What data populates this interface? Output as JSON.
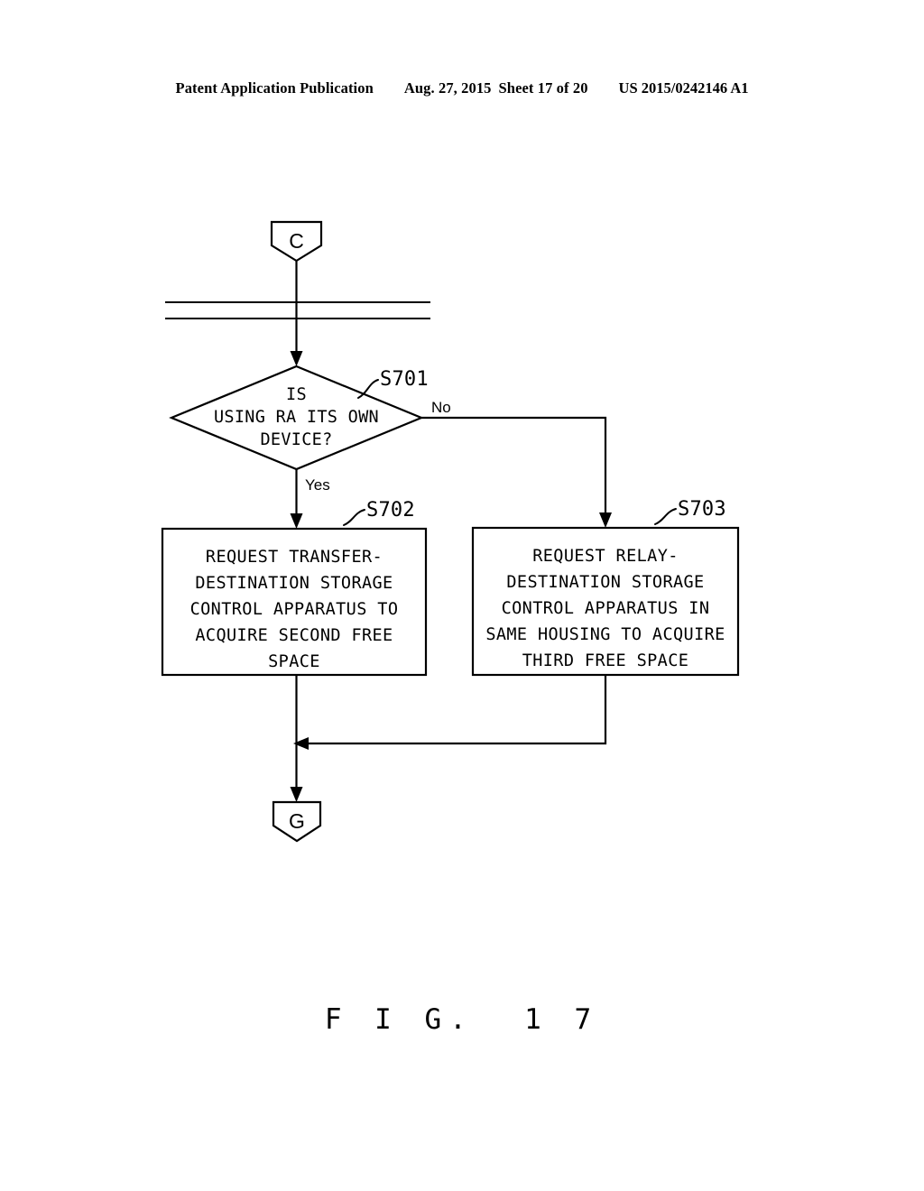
{
  "header": {
    "publication": "Patent Application Publication",
    "date": "Aug. 27, 2015",
    "sheet": "Sheet 17 of 20",
    "patent_number": "US 2015/0242146 A1"
  },
  "caption": "F I G.  1 7",
  "flowchart": {
    "connector_in": {
      "label": "C",
      "name": "connector-c"
    },
    "connector_out": {
      "label": "G",
      "name": "connector-g"
    },
    "break_marker": {
      "name": "flow-break-lines",
      "line_count": 2
    },
    "decision": {
      "step_id": "S701",
      "line1": "IS",
      "line2": "USING RA ITS OWN",
      "line3": "DEVICE?",
      "yes_label": "Yes",
      "no_label": "No"
    },
    "process_left": {
      "step_id": "S702",
      "lines": [
        "REQUEST TRANSFER-",
        "DESTINATION STORAGE",
        "CONTROL APPARATUS TO",
        "ACQUIRE SECOND FREE",
        "SPACE"
      ]
    },
    "process_right": {
      "step_id": "S703",
      "lines": [
        "REQUEST RELAY-",
        "DESTINATION STORAGE",
        "CONTROL APPARATUS IN",
        "SAME HOUSING TO ACQUIRE",
        "THIRD FREE SPACE"
      ]
    }
  },
  "colors": {
    "ink": "#000000",
    "paper": "#ffffff"
  }
}
